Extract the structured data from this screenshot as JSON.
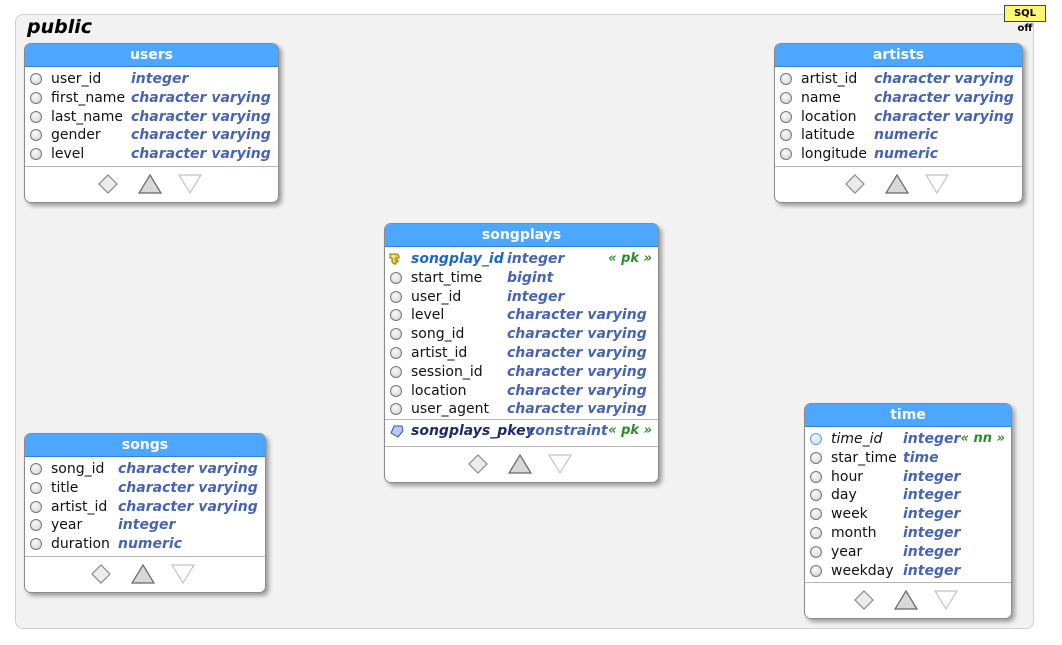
{
  "schema": {
    "title": "public",
    "sql_toggle": "SQL off"
  },
  "tables": {
    "users": {
      "name": "users",
      "columns": [
        {
          "name": "user_id",
          "type": "integer"
        },
        {
          "name": "first_name",
          "type": "character varying"
        },
        {
          "name": "last_name",
          "type": "character varying"
        },
        {
          "name": "gender",
          "type": "character varying"
        },
        {
          "name": "level",
          "type": "character varying"
        }
      ]
    },
    "artists": {
      "name": "artists",
      "columns": [
        {
          "name": "artist_id",
          "type": "character varying"
        },
        {
          "name": "name",
          "type": "character varying"
        },
        {
          "name": "location",
          "type": "character varying"
        },
        {
          "name": "latitude",
          "type": "numeric"
        },
        {
          "name": "longitude",
          "type": "numeric"
        }
      ]
    },
    "songplays": {
      "name": "songplays",
      "columns": [
        {
          "name": "songplay_id",
          "type": "integer",
          "tag": "« pk »"
        },
        {
          "name": "start_time",
          "type": "bigint"
        },
        {
          "name": "user_id",
          "type": "integer"
        },
        {
          "name": "level",
          "type": "character varying"
        },
        {
          "name": "song_id",
          "type": "character varying"
        },
        {
          "name": "artist_id",
          "type": "character varying"
        },
        {
          "name": "session_id",
          "type": "character varying"
        },
        {
          "name": "location",
          "type": "character varying"
        },
        {
          "name": "user_agent",
          "type": "character varying"
        }
      ],
      "constraint": {
        "name": "songplays_pkey",
        "type": "constraint",
        "tag": "« pk »"
      }
    },
    "songs": {
      "name": "songs",
      "columns": [
        {
          "name": "song_id",
          "type": "character varying"
        },
        {
          "name": "title",
          "type": "character varying"
        },
        {
          "name": "artist_id",
          "type": "character varying"
        },
        {
          "name": "year",
          "type": "integer"
        },
        {
          "name": "duration",
          "type": "numeric"
        }
      ]
    },
    "time": {
      "name": "time",
      "columns": [
        {
          "name": "time_id",
          "type": "integer",
          "tag": "« nn »"
        },
        {
          "name": "star_time",
          "type": "time"
        },
        {
          "name": "hour",
          "type": "integer"
        },
        {
          "name": "day",
          "type": "integer"
        },
        {
          "name": "week",
          "type": "integer"
        },
        {
          "name": "month",
          "type": "integer"
        },
        {
          "name": "year",
          "type": "integer"
        },
        {
          "name": "weekday",
          "type": "integer"
        }
      ]
    }
  },
  "colors": {
    "header": "#4da6ff",
    "type_text": "#4764b0",
    "tag_text": "#2a8f2a",
    "pk_text": "#1a6ac4",
    "sql_toggle_bg": "#fff675"
  },
  "icons": {
    "pk_column": "key-icon",
    "nn_column": "blue-circle-icon",
    "column": "circle-icon",
    "constraint": "pentagon-icon",
    "footer": [
      "diamond-icon",
      "triangle-up-icon",
      "triangle-down-icon"
    ]
  }
}
